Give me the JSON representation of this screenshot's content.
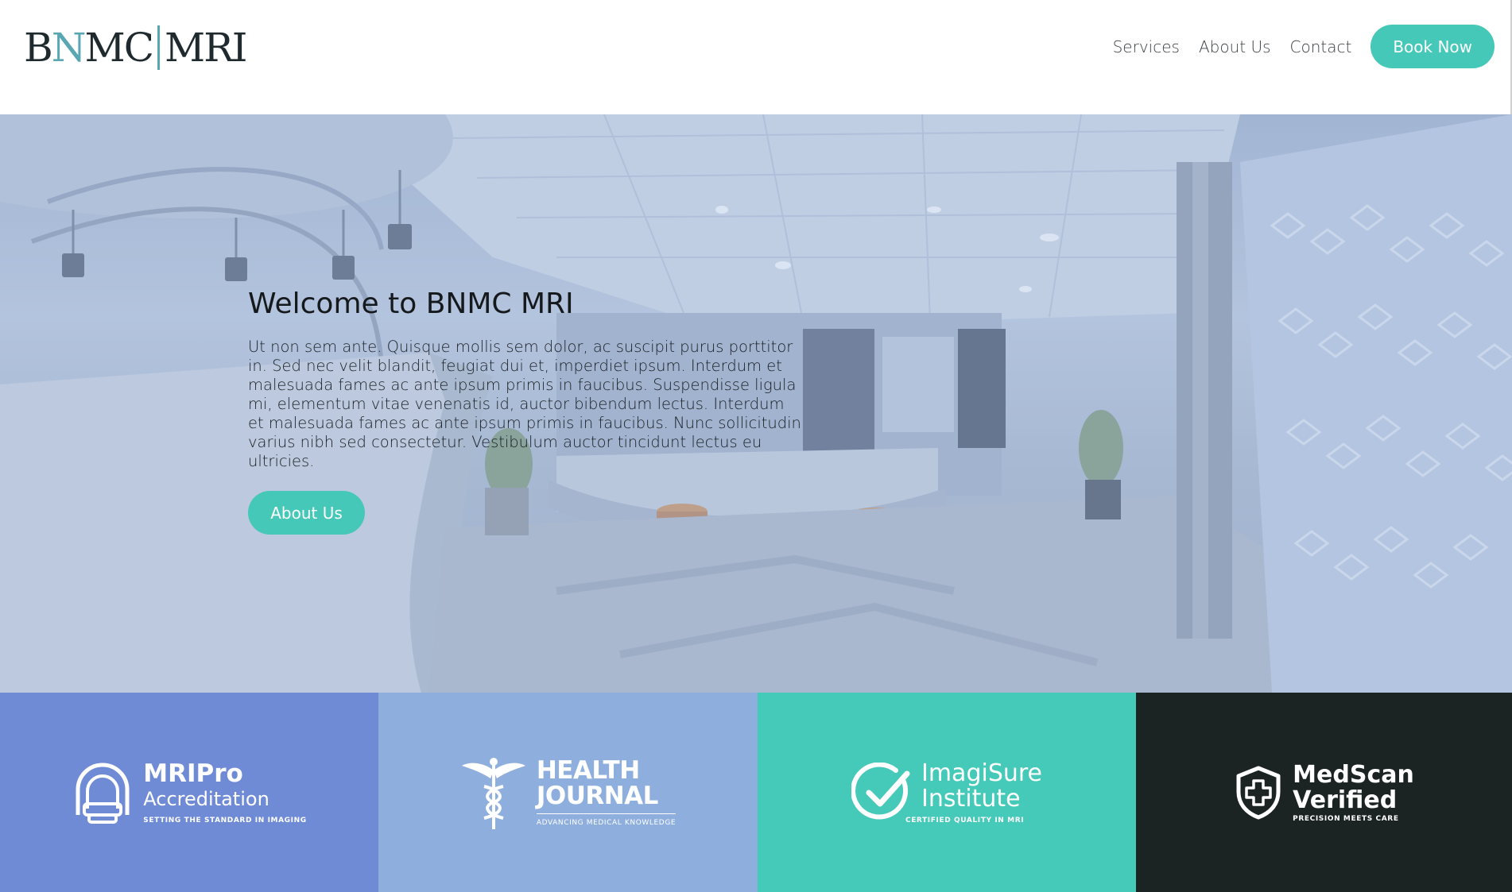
{
  "header": {
    "logo": {
      "part1": "B",
      "part2": "N",
      "part3": "MC",
      "part4": "MRI"
    },
    "nav": [
      {
        "label": "Services"
      },
      {
        "label": "About Us"
      },
      {
        "label": "Contact"
      }
    ],
    "cta_label": "Book Now"
  },
  "hero": {
    "title": "Welcome to BNMC MRI",
    "body": "Ut non sem ante. Quisque mollis sem dolor, ac suscipit purus porttitor in. Sed nec velit blandit, feugiat dui et, imperdiet ipsum. Interdum et malesuada fames ac ante ipsum primis in faucibus. Suspendisse ligula mi, elementum vitae venenatis id, auctor bibendum lectus. Interdum et malesuada fames ac ante ipsum primis in faucibus. Nunc sollicitudin varius nibh sed consectetur. Vestibulum auctor tincidunt lectus eu ultricies.",
    "button_label": "About Us"
  },
  "partners": [
    {
      "name_line1": "MRIPro",
      "name_line2": "Accreditation",
      "tagline": "SETTING THE STANDARD IN IMAGING",
      "icon": "mri-scanner-icon"
    },
    {
      "name_line1": "HEALTH",
      "name_line2": "JOURNAL",
      "tagline": "ADVANCING MEDICAL KNOWLEDGE",
      "icon": "caduceus-icon"
    },
    {
      "name_line1": "ImagiSure",
      "name_line2": "Institute",
      "tagline": "CERTIFIED QUALITY IN MRI",
      "icon": "check-circle-icon"
    },
    {
      "name_line1": "MedScan",
      "name_line2": "Verified",
      "tagline": "PRECISION MEETS CARE",
      "icon": "shield-cross-icon"
    }
  ],
  "colors": {
    "accent": "#45c8b8",
    "logo_accent": "#5aa7b4",
    "tile1": "#6f8bd6",
    "tile2": "#8eaede",
    "tile3": "#45c9b8",
    "tile4": "#1c2323"
  }
}
